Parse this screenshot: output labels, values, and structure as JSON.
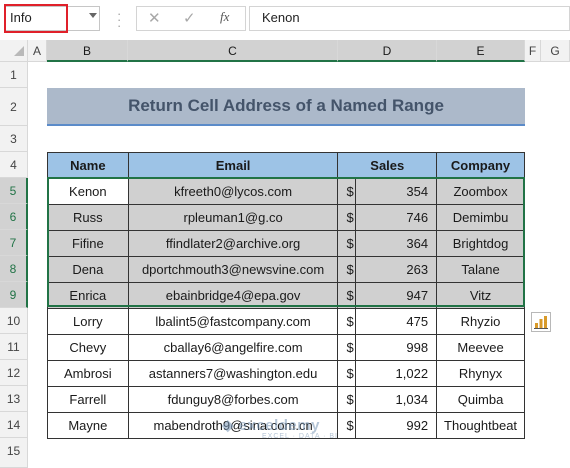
{
  "name_box": {
    "value": "Info"
  },
  "formula_bar": {
    "fx_label": "fx",
    "value": "Kenon"
  },
  "columns": [
    "A",
    "B",
    "C",
    "D",
    "E",
    "F",
    "G"
  ],
  "rows": [
    "1",
    "2",
    "3",
    "4",
    "5",
    "6",
    "7",
    "8",
    "9",
    "10",
    "11",
    "12",
    "13",
    "14",
    "15"
  ],
  "sheet_title": "Return Cell Address of a Named Range",
  "table": {
    "headers": [
      "Name",
      "Email",
      "Sales",
      "Company"
    ],
    "currency_symbol": "$",
    "rows": [
      {
        "name": "Kenon",
        "email": "kfreeth0@lycos.com",
        "sales": "354",
        "company": "Zoombox"
      },
      {
        "name": "Russ",
        "email": "rpleuman1@g.co",
        "sales": "746",
        "company": "Demimbu"
      },
      {
        "name": "Fifine",
        "email": "ffindlater2@archive.org",
        "sales": "364",
        "company": "Brightdog"
      },
      {
        "name": "Dena",
        "email": "dportchmouth3@newsvine.com",
        "sales": "263",
        "company": "Talane"
      },
      {
        "name": "Enrica",
        "email": "ebainbridge4@epa.gov",
        "sales": "947",
        "company": "Vitz"
      },
      {
        "name": "Lorry",
        "email": "lbalint5@fastcompany.com",
        "sales": "475",
        "company": "Rhyzio"
      },
      {
        "name": "Chevy",
        "email": "cballay6@angelfire.com",
        "sales": "998",
        "company": "Meevee"
      },
      {
        "name": "Ambrosi",
        "email": "astanners7@washington.edu",
        "sales": "1,022",
        "company": "Rhynyx"
      },
      {
        "name": "Farrell",
        "email": "fdunguy8@forbes.com",
        "sales": "1,034",
        "company": "Quimba"
      },
      {
        "name": "Mayne",
        "email": "mabendroth9@sina.com.cn",
        "sales": "992",
        "company": "Thoughtbeat"
      }
    ]
  },
  "watermark": {
    "brand": "exceldemy",
    "tagline": "EXCEL · DATA · BI"
  },
  "colors": {
    "accent_green": "#217346",
    "header_fill": "#9dc3e6",
    "title_fill": "#acb9ca",
    "selection_fill": "#d0d0d0",
    "namebox_highlight": "#e0202a"
  }
}
